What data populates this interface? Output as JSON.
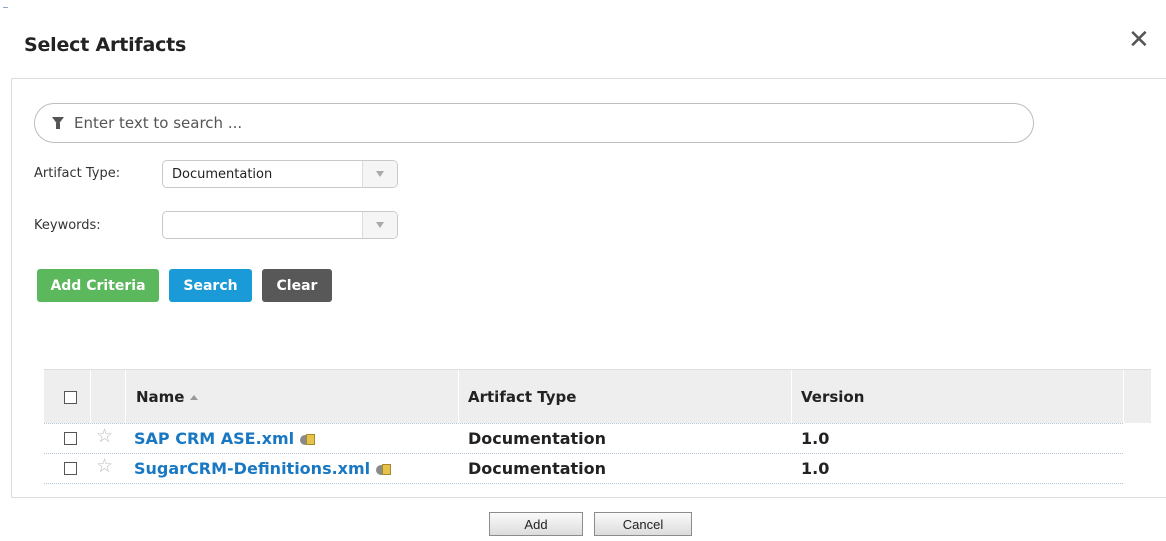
{
  "dialog": {
    "title": "Select Artifacts",
    "close_symbol": "✕"
  },
  "search": {
    "placeholder": "Enter text to search ..."
  },
  "filters": {
    "artifact_type_label": "Artifact Type:",
    "artifact_type_value": "Documentation",
    "keywords_label": "Keywords:",
    "keywords_value": ""
  },
  "buttons": {
    "add_criteria": "Add Criteria",
    "search": "Search",
    "clear": "Clear"
  },
  "table": {
    "columns": [
      "Name",
      "Artifact Type",
      "Version"
    ],
    "sort_column": "Name",
    "rows": [
      {
        "name": "SAP CRM ASE.xml",
        "type": "Documentation",
        "version": "1.0"
      },
      {
        "name": "SugarCRM-Definitions.xml",
        "type": "Documentation",
        "version": "1.0"
      }
    ]
  },
  "footer": {
    "add": "Add",
    "cancel": "Cancel"
  },
  "colors": {
    "green_button": "#5cb85c",
    "blue_button": "#1a9ad6",
    "dark_button": "#585858",
    "link": "#1a78c2"
  }
}
